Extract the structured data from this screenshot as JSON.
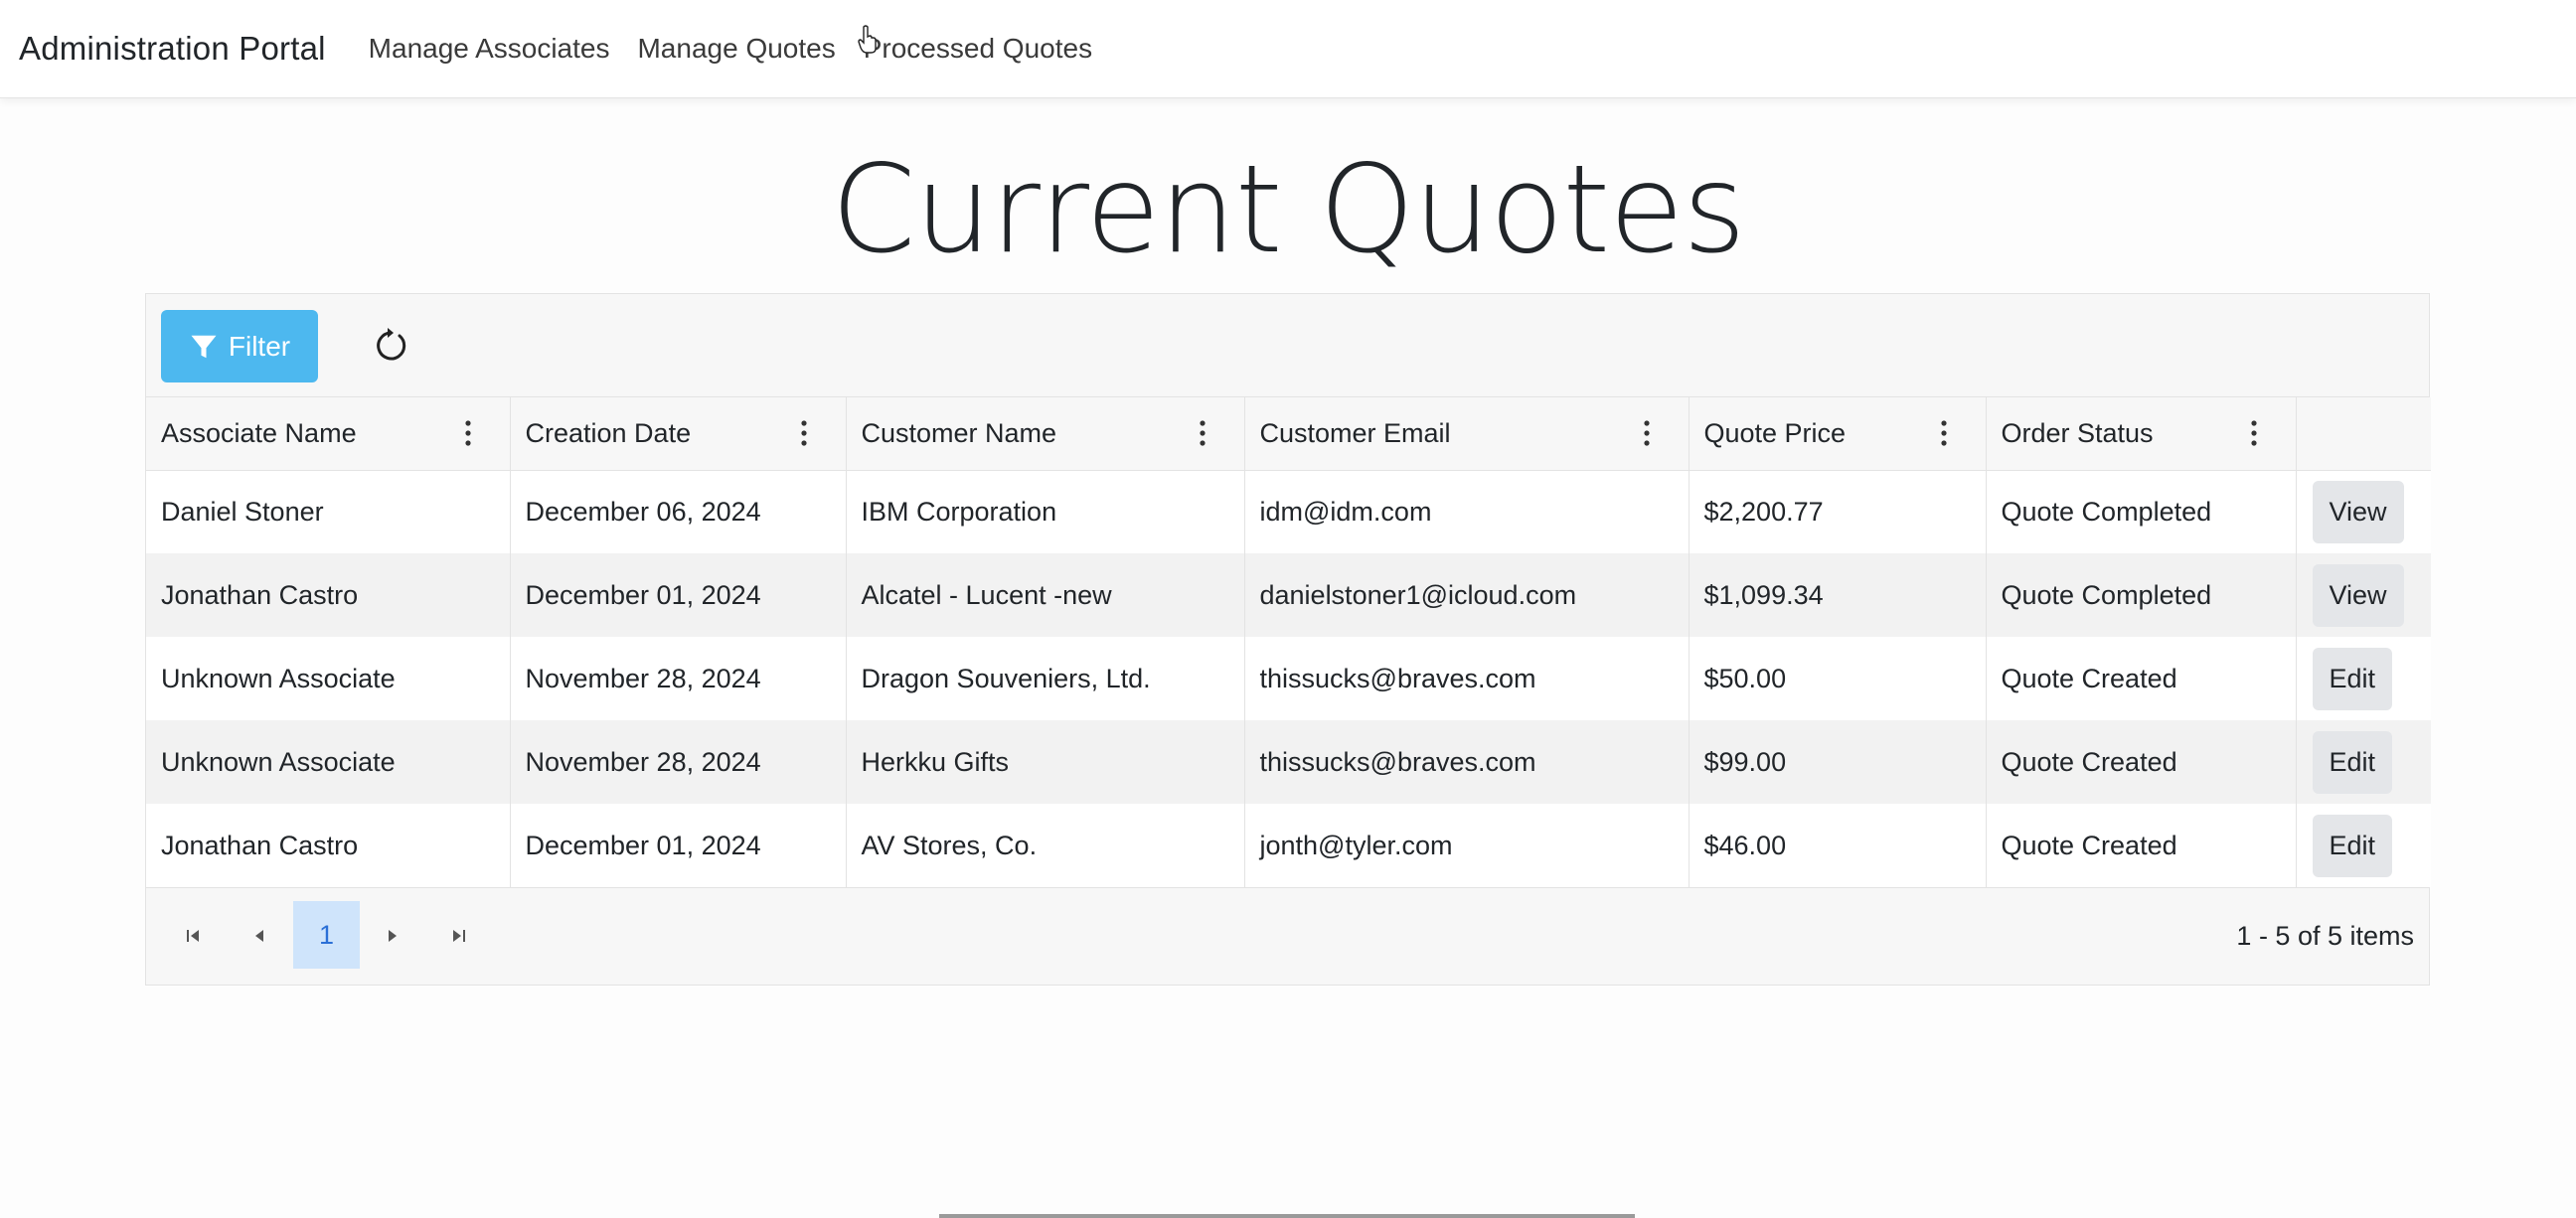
{
  "nav": {
    "brand": "Administration Portal",
    "links": [
      "Manage Associates",
      "Manage Quotes",
      "Processed Quotes"
    ]
  },
  "page": {
    "title": "Current Quotes"
  },
  "toolbar": {
    "filter_label": "Filter",
    "filter_icon": "filter-icon",
    "refresh_icon": "refresh-icon"
  },
  "grid": {
    "columns": [
      "Associate Name",
      "Creation Date",
      "Customer Name",
      "Customer Email",
      "Quote Price",
      "Order Status"
    ],
    "rows": [
      {
        "associate": "Daniel Stoner",
        "date": "December 06, 2024",
        "customer": "IBM Corporation",
        "email": "idm@idm.com",
        "price": "$2,200.77",
        "status": "Quote Completed",
        "action": "View"
      },
      {
        "associate": "Jonathan Castro",
        "date": "December 01, 2024",
        "customer": "Alcatel - Lucent -new",
        "email": "danielstoner1@icloud.com",
        "price": "$1,099.34",
        "status": "Quote Completed",
        "action": "View"
      },
      {
        "associate": "Unknown Associate",
        "date": "November 28, 2024",
        "customer": "Dragon Souveniers, Ltd.",
        "email": "thissucks@braves.com",
        "price": "$50.00",
        "status": "Quote Created",
        "action": "Edit"
      },
      {
        "associate": "Unknown Associate",
        "date": "November 28, 2024",
        "customer": "Herkku Gifts",
        "email": "thissucks@braves.com",
        "price": "$99.00",
        "status": "Quote Created",
        "action": "Edit"
      },
      {
        "associate": "Jonathan Castro",
        "date": "December 01, 2024",
        "customer": "AV Stores, Co.",
        "email": "jonth@tyler.com",
        "price": "$46.00",
        "status": "Quote Created",
        "action": "Edit"
      }
    ]
  },
  "pager": {
    "current_page": "1",
    "info": "1 - 5 of 5 items"
  },
  "colors": {
    "accent": "#4db8ef",
    "page_active_bg": "#cfe4fb",
    "page_active_text": "#2b6fd6"
  }
}
